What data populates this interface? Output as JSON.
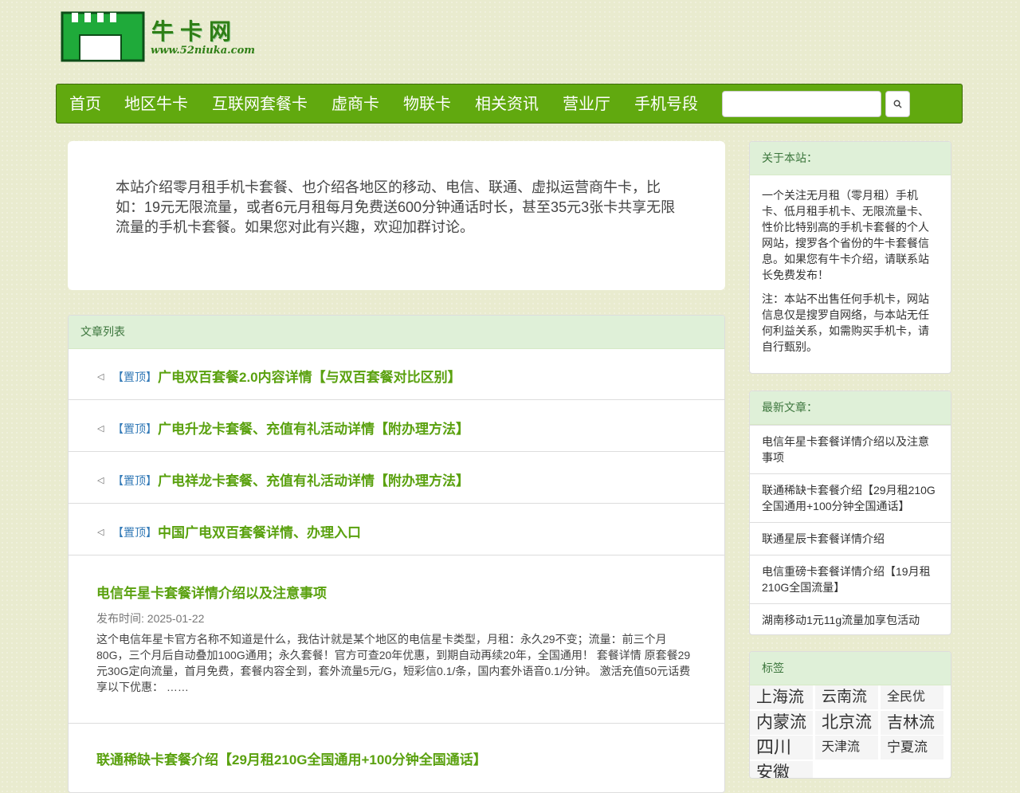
{
  "logo": {
    "text": "牛卡网",
    "url": "www.52niuka.com"
  },
  "nav": {
    "items": [
      "首页",
      "地区牛卡",
      "互联网套餐卡",
      "虚商卡",
      "物联卡",
      "相关资讯",
      "营业厅",
      "手机号段"
    ],
    "search_placeholder": "",
    "search_button": ""
  },
  "intro": "本站介绍零月租手机卡套餐、也介绍各地区的移动、电信、联通、虚拟运营商牛卡，比如：19元无限流量，或者6元月租每月免费送600分钟通话时长，甚至35元3张卡共享无限流量的手机卡套餐。如果您对此有兴趣，欢迎加群讨论。",
  "articles": {
    "heading": "文章列表",
    "pin_badge": "【置顶】",
    "pinned": [
      "广电双百套餐2.0内容详情【与双百套餐对比区别】",
      "广电升龙卡套餐、充值有礼活动详情【附办理方法】",
      "广电祥龙卡套餐、充值有礼活动详情【附办理方法】",
      "中国广电双百套餐详情、办理入口"
    ],
    "posts": [
      {
        "title": "电信年星卡套餐详情介绍以及注意事项",
        "date": "发布时间: 2025-01-22",
        "excerpt": "这个电信年星卡官方名称不知道是什么，我估计就是某个地区的电信星卡类型，月租：永久29不变；流量：前三个月80G，三个月后自动叠加100G通用；永久套餐！官方可查20年优惠，到期自动再续20年，全国通用！ 套餐详情 原套餐29元30G定向流量，首月免费，套餐内容全到，套外流量5元/G，短彩信0.1/条，国内套外语音0.1/分钟。 激活充值50元话费享以下优惠： ……"
      },
      {
        "title": "联通稀缺卡套餐介绍【29月租210G全国通用+100分钟全国通话】"
      }
    ]
  },
  "sidebar": {
    "about": {
      "heading": "关于本站：",
      "p1": "一个关注无月租（零月租）手机卡、低月租手机卡、无限流量卡、性价比特别高的手机卡套餐的个人网站，搜罗各个省份的牛卡套餐信息。如果您有牛卡介绍，请联系站长免费发布！",
      "p2": "注：本站不出售任何手机卡，网站信息仅是搜罗自网络，与本站无任何利益关系，如需购买手机卡，请自行甄别。"
    },
    "latest": {
      "heading": "最新文章：",
      "items": [
        "电信年星卡套餐详情介绍以及注意事项",
        "联通稀缺卡套餐介绍【29月租210G全国通用+100分钟全国通话】",
        "联通星辰卡套餐详情介绍",
        "电信重磅卡套餐详情介绍【19月租210G全国流量】",
        "湖南移动1元11g流量加享包活动"
      ]
    },
    "tags": {
      "heading": "标签",
      "items": [
        "上海流",
        "云南流",
        "全民优",
        "内蒙流",
        "北京流",
        "吉林流",
        "四川",
        "天津流",
        "宁夏流",
        "安徽"
      ]
    }
  },
  "colors": {
    "nav": "#61a90f",
    "link": "#5aa10f",
    "panel_head": "#dff0d8",
    "panel_head_text": "#3c763d",
    "badge": "#337ab7"
  }
}
